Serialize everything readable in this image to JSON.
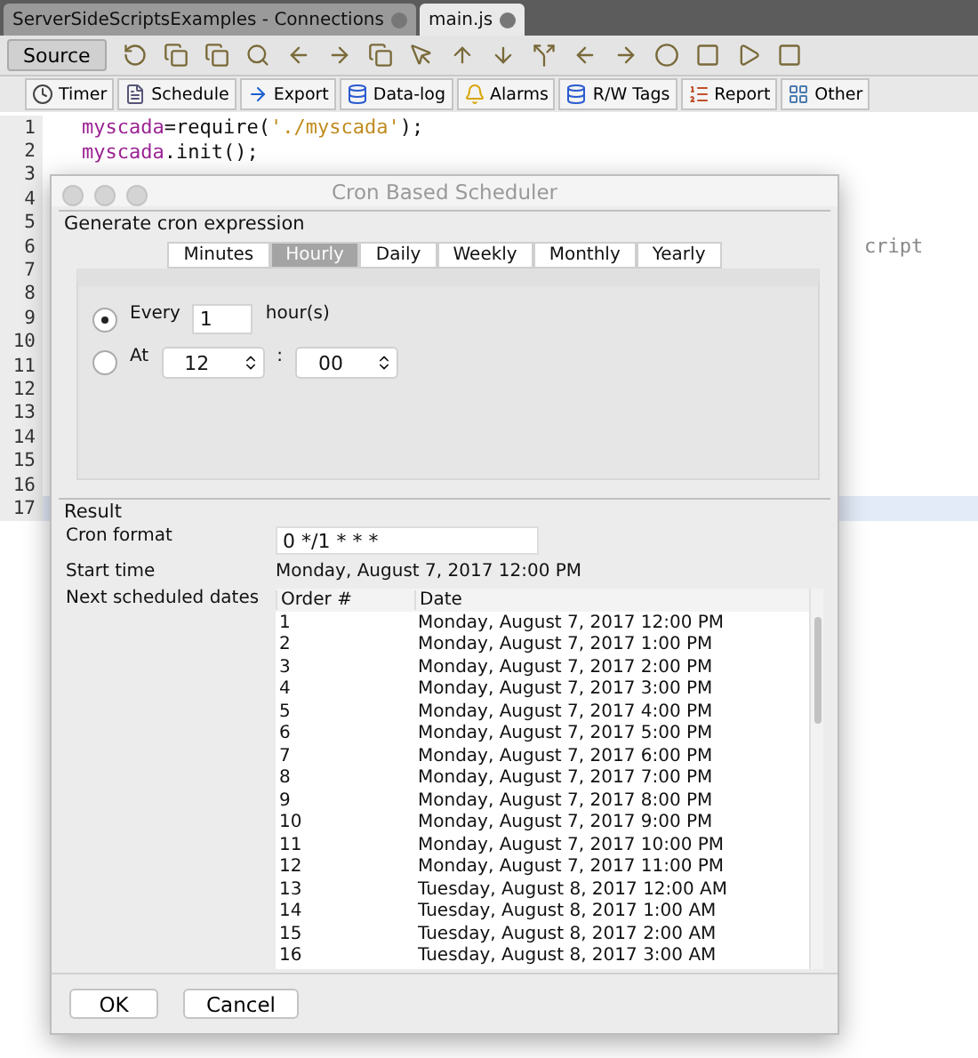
{
  "editor_tabs": [
    {
      "label": "ServerSideScriptsExamples - Connections",
      "selected": false
    },
    {
      "label": "main.js",
      "selected": true
    }
  ],
  "source_button": {
    "label": "Source",
    "selected": true
  },
  "script_toolbar": [
    {
      "label": "Timer",
      "kind": "timer"
    },
    {
      "label": "Schedule",
      "kind": "schedule"
    },
    {
      "label": "Export",
      "kind": "export"
    },
    {
      "label": "Data-log",
      "kind": "datalog"
    },
    {
      "label": "Alarms",
      "kind": "alarms"
    },
    {
      "label": "R/W Tags",
      "kind": "tags"
    },
    {
      "label": "Report",
      "kind": "report"
    },
    {
      "label": "Other",
      "kind": "other"
    }
  ],
  "code_lines": [
    {
      "number": "1",
      "current": false,
      "tokens": [
        {
          "text": "myscada",
          "kind": "ident"
        },
        {
          "text": "=require(",
          "kind": "plain"
        },
        {
          "text": "'./myscada'",
          "kind": "string"
        },
        {
          "text": ");",
          "kind": "plain"
        }
      ]
    },
    {
      "number": "2",
      "current": false,
      "tokens": [
        {
          "text": "myscada",
          "kind": "ident"
        },
        {
          "text": ".init();",
          "kind": "plain"
        }
      ]
    },
    {
      "number": "3",
      "current": false
    },
    {
      "number": "4",
      "current": false
    },
    {
      "number": "5",
      "current": false
    },
    {
      "number": "6",
      "current": false,
      "tokens": [
        {
          "text": "cript",
          "kind": "tail"
        }
      ]
    },
    {
      "number": "7",
      "current": false
    },
    {
      "number": "8",
      "current": false
    },
    {
      "number": "9",
      "current": false
    },
    {
      "number": "10",
      "current": false
    },
    {
      "number": "11",
      "current": false
    },
    {
      "number": "12",
      "current": false
    },
    {
      "number": "13",
      "current": false
    },
    {
      "number": "14",
      "current": false
    },
    {
      "number": "15",
      "current": false
    },
    {
      "number": "16",
      "current": false
    },
    {
      "number": "17",
      "current": true
    }
  ],
  "dialog": {
    "title": "Cron Based Scheduler",
    "generate": {
      "legend": "Generate cron expression",
      "tabs": [
        {
          "label": "Minutes",
          "selected": false
        },
        {
          "label": "Hourly",
          "selected": true
        },
        {
          "label": "Daily",
          "selected": false
        },
        {
          "label": "Weekly",
          "selected": false
        },
        {
          "label": "Monthly",
          "selected": false
        },
        {
          "label": "Yearly",
          "selected": false
        }
      ],
      "every": {
        "label": "Every",
        "selected": true,
        "value": "1",
        "unit": "hour(s)"
      },
      "at": {
        "label": "At",
        "selected": false,
        "hour": "12",
        "separator": ":",
        "minute": "00"
      }
    },
    "result": {
      "legend": "Result",
      "cron_label": "Cron format",
      "cron_value": "0 */1 * * *",
      "start_label": "Start time",
      "start_value": "Monday, August 7, 2017 12:00 PM",
      "next_label": "Next scheduled dates",
      "table": {
        "columns": [
          "Order #",
          "Date"
        ],
        "rows": [
          [
            "1",
            "Monday, August 7, 2017 12:00 PM"
          ],
          [
            "2",
            "Monday, August 7, 2017 1:00 PM"
          ],
          [
            "3",
            "Monday, August 7, 2017 2:00 PM"
          ],
          [
            "4",
            "Monday, August 7, 2017 3:00 PM"
          ],
          [
            "5",
            "Monday, August 7, 2017 4:00 PM"
          ],
          [
            "6",
            "Monday, August 7, 2017 5:00 PM"
          ],
          [
            "7",
            "Monday, August 7, 2017 6:00 PM"
          ],
          [
            "8",
            "Monday, August 7, 2017 7:00 PM"
          ],
          [
            "9",
            "Monday, August 7, 2017 8:00 PM"
          ],
          [
            "10",
            "Monday, August 7, 2017 9:00 PM"
          ],
          [
            "11",
            "Monday, August 7, 2017 10:00 PM"
          ],
          [
            "12",
            "Monday, August 7, 2017 11:00 PM"
          ],
          [
            "13",
            "Tuesday, August 8, 2017 12:00 AM"
          ],
          [
            "14",
            "Tuesday, August 8, 2017 1:00 AM"
          ],
          [
            "15",
            "Tuesday, August 8, 2017 2:00 AM"
          ],
          [
            "16",
            "Tuesday, August 8, 2017 3:00 AM"
          ]
        ]
      }
    },
    "buttons": [
      "OK",
      "Cancel"
    ]
  }
}
